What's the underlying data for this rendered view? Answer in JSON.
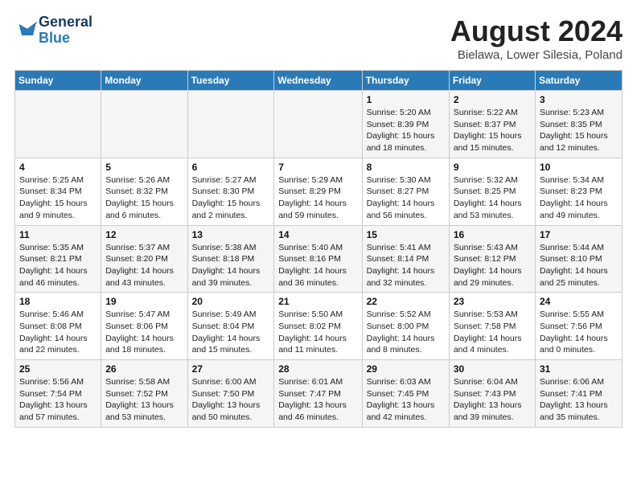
{
  "header": {
    "logo_line1": "General",
    "logo_line2": "Blue",
    "title": "August 2024",
    "subtitle": "Bielawa, Lower Silesia, Poland"
  },
  "weekdays": [
    "Sunday",
    "Monday",
    "Tuesday",
    "Wednesday",
    "Thursday",
    "Friday",
    "Saturday"
  ],
  "weeks": [
    [
      {
        "day": "",
        "sunrise": "",
        "sunset": "",
        "daylight": ""
      },
      {
        "day": "",
        "sunrise": "",
        "sunset": "",
        "daylight": ""
      },
      {
        "day": "",
        "sunrise": "",
        "sunset": "",
        "daylight": ""
      },
      {
        "day": "",
        "sunrise": "",
        "sunset": "",
        "daylight": ""
      },
      {
        "day": "1",
        "sunrise": "5:20 AM",
        "sunset": "8:39 PM",
        "daylight": "15 hours and 18 minutes."
      },
      {
        "day": "2",
        "sunrise": "5:22 AM",
        "sunset": "8:37 PM",
        "daylight": "15 hours and 15 minutes."
      },
      {
        "day": "3",
        "sunrise": "5:23 AM",
        "sunset": "8:35 PM",
        "daylight": "15 hours and 12 minutes."
      }
    ],
    [
      {
        "day": "4",
        "sunrise": "5:25 AM",
        "sunset": "8:34 PM",
        "daylight": "15 hours and 9 minutes."
      },
      {
        "day": "5",
        "sunrise": "5:26 AM",
        "sunset": "8:32 PM",
        "daylight": "15 hours and 6 minutes."
      },
      {
        "day": "6",
        "sunrise": "5:27 AM",
        "sunset": "8:30 PM",
        "daylight": "15 hours and 2 minutes."
      },
      {
        "day": "7",
        "sunrise": "5:29 AM",
        "sunset": "8:29 PM",
        "daylight": "14 hours and 59 minutes."
      },
      {
        "day": "8",
        "sunrise": "5:30 AM",
        "sunset": "8:27 PM",
        "daylight": "14 hours and 56 minutes."
      },
      {
        "day": "9",
        "sunrise": "5:32 AM",
        "sunset": "8:25 PM",
        "daylight": "14 hours and 53 minutes."
      },
      {
        "day": "10",
        "sunrise": "5:34 AM",
        "sunset": "8:23 PM",
        "daylight": "14 hours and 49 minutes."
      }
    ],
    [
      {
        "day": "11",
        "sunrise": "5:35 AM",
        "sunset": "8:21 PM",
        "daylight": "14 hours and 46 minutes."
      },
      {
        "day": "12",
        "sunrise": "5:37 AM",
        "sunset": "8:20 PM",
        "daylight": "14 hours and 43 minutes."
      },
      {
        "day": "13",
        "sunrise": "5:38 AM",
        "sunset": "8:18 PM",
        "daylight": "14 hours and 39 minutes."
      },
      {
        "day": "14",
        "sunrise": "5:40 AM",
        "sunset": "8:16 PM",
        "daylight": "14 hours and 36 minutes."
      },
      {
        "day": "15",
        "sunrise": "5:41 AM",
        "sunset": "8:14 PM",
        "daylight": "14 hours and 32 minutes."
      },
      {
        "day": "16",
        "sunrise": "5:43 AM",
        "sunset": "8:12 PM",
        "daylight": "14 hours and 29 minutes."
      },
      {
        "day": "17",
        "sunrise": "5:44 AM",
        "sunset": "8:10 PM",
        "daylight": "14 hours and 25 minutes."
      }
    ],
    [
      {
        "day": "18",
        "sunrise": "5:46 AM",
        "sunset": "8:08 PM",
        "daylight": "14 hours and 22 minutes."
      },
      {
        "day": "19",
        "sunrise": "5:47 AM",
        "sunset": "8:06 PM",
        "daylight": "14 hours and 18 minutes."
      },
      {
        "day": "20",
        "sunrise": "5:49 AM",
        "sunset": "8:04 PM",
        "daylight": "14 hours and 15 minutes."
      },
      {
        "day": "21",
        "sunrise": "5:50 AM",
        "sunset": "8:02 PM",
        "daylight": "14 hours and 11 minutes."
      },
      {
        "day": "22",
        "sunrise": "5:52 AM",
        "sunset": "8:00 PM",
        "daylight": "14 hours and 8 minutes."
      },
      {
        "day": "23",
        "sunrise": "5:53 AM",
        "sunset": "7:58 PM",
        "daylight": "14 hours and 4 minutes."
      },
      {
        "day": "24",
        "sunrise": "5:55 AM",
        "sunset": "7:56 PM",
        "daylight": "14 hours and 0 minutes."
      }
    ],
    [
      {
        "day": "25",
        "sunrise": "5:56 AM",
        "sunset": "7:54 PM",
        "daylight": "13 hours and 57 minutes."
      },
      {
        "day": "26",
        "sunrise": "5:58 AM",
        "sunset": "7:52 PM",
        "daylight": "13 hours and 53 minutes."
      },
      {
        "day": "27",
        "sunrise": "6:00 AM",
        "sunset": "7:50 PM",
        "daylight": "13 hours and 50 minutes."
      },
      {
        "day": "28",
        "sunrise": "6:01 AM",
        "sunset": "7:47 PM",
        "daylight": "13 hours and 46 minutes."
      },
      {
        "day": "29",
        "sunrise": "6:03 AM",
        "sunset": "7:45 PM",
        "daylight": "13 hours and 42 minutes."
      },
      {
        "day": "30",
        "sunrise": "6:04 AM",
        "sunset": "7:43 PM",
        "daylight": "13 hours and 39 minutes."
      },
      {
        "day": "31",
        "sunrise": "6:06 AM",
        "sunset": "7:41 PM",
        "daylight": "13 hours and 35 minutes."
      }
    ]
  ]
}
